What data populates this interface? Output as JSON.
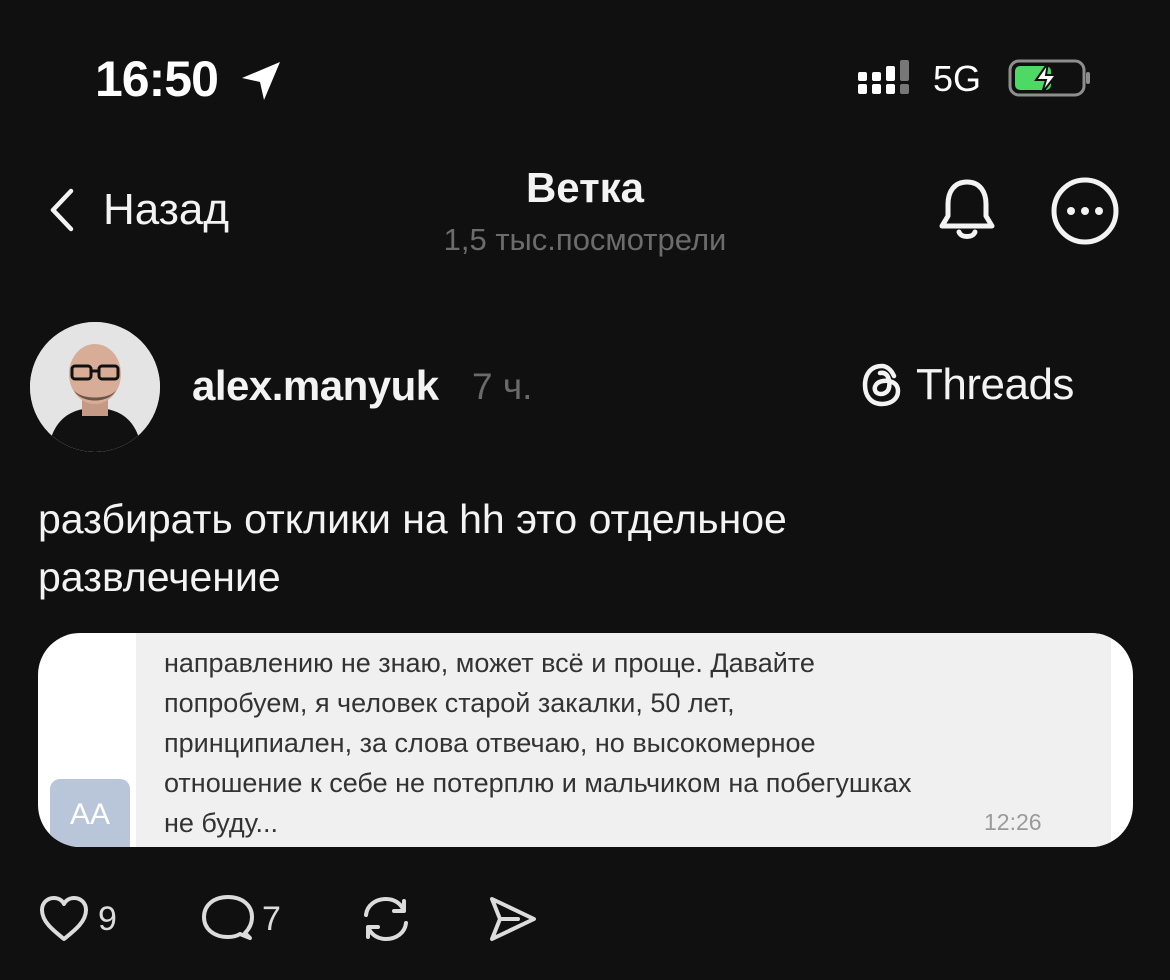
{
  "status_bar": {
    "time": "16:50",
    "location_icon": "location-arrow-icon",
    "signal_icon": "cellular-signal-icon",
    "network": "5G",
    "battery_icon": "battery-charging-icon",
    "battery_color": "#4cd964"
  },
  "nav": {
    "back_label": "Назад",
    "title": "Ветка",
    "subtitle": "1,5 тыс.посмотрели",
    "bell_icon": "bell-icon",
    "more_icon": "more-icon"
  },
  "post": {
    "username": "alex.manyuk",
    "time_ago": "7 ч.",
    "brand_label": "Threads",
    "text_line1": "разбирать отклики на hh это отдельное",
    "text_line2": "развлечение",
    "screenshot": {
      "avatar_initials": "AA",
      "lines": [
        "направлению не знаю, может всё и проще. Давайте",
        "попробуем, я человек старой закалки, 50 лет,",
        "принципиален, за слова отвечаю, но высокомерное",
        "отношение к себе не потерплю и мальчиком на побегушках",
        "не буду..."
      ],
      "time": "12:26"
    },
    "actions": {
      "likes": "9",
      "replies": "7"
    }
  },
  "colors": {
    "background": "#101010",
    "text": "#f3f3f3",
    "muted": "#6c6c6c"
  }
}
